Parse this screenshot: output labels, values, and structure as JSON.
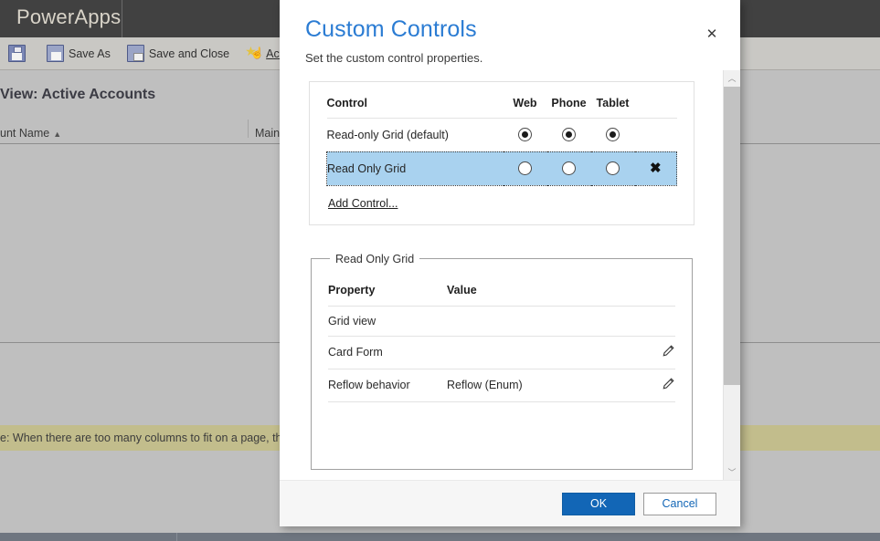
{
  "background": {
    "brand": "PowerApps",
    "toolbar": {
      "save_label": "",
      "save_as_label": "Save As",
      "save_and_close_label": "Save and Close",
      "actions_label": "Actions",
      "actions_caret": "▾"
    },
    "view_title": "View: Active Accounts",
    "columns": [
      {
        "label": "unt Name",
        "sort": "▲"
      },
      {
        "label": "Main",
        "sort": ""
      }
    ],
    "notice": "e: When there are too many columns to fit on a page, the view w"
  },
  "dialog": {
    "title": "Custom Controls",
    "subtitle": "Set the custom control properties.",
    "close_icon": "✕",
    "controls": {
      "headers": {
        "control": "Control",
        "web": "Web",
        "phone": "Phone",
        "tablet": "Tablet"
      },
      "rows": [
        {
          "name": "Read-only Grid (default)",
          "web": true,
          "phone": true,
          "tablet": true,
          "selected": false,
          "deletable": false,
          "delete_icon": ""
        },
        {
          "name": "Read Only Grid",
          "web": false,
          "phone": false,
          "tablet": false,
          "selected": true,
          "deletable": true,
          "delete_icon": "✖"
        }
      ],
      "add_control_label": "Add Control..."
    },
    "properties": {
      "legend": "Read Only Grid",
      "headers": {
        "property": "Property",
        "value": "Value",
        "edit": ""
      },
      "rows": [
        {
          "property": "Grid view",
          "value": "",
          "editable": false
        },
        {
          "property": "Card Form",
          "value": "",
          "editable": true
        },
        {
          "property": "Reflow behavior",
          "value": "Reflow (Enum)",
          "editable": true
        }
      ]
    },
    "scrollbar": {
      "up_icon": "︿",
      "down_icon": "﹀"
    },
    "footer": {
      "ok_label": "OK",
      "cancel_label": "Cancel"
    }
  },
  "colors": {
    "accent_blue": "#2b7cd3",
    "primary_button": "#1266b6",
    "row_highlight": "#a9d2ef",
    "notice_bar": "#c2bd8c",
    "titlebar": "#414141"
  }
}
